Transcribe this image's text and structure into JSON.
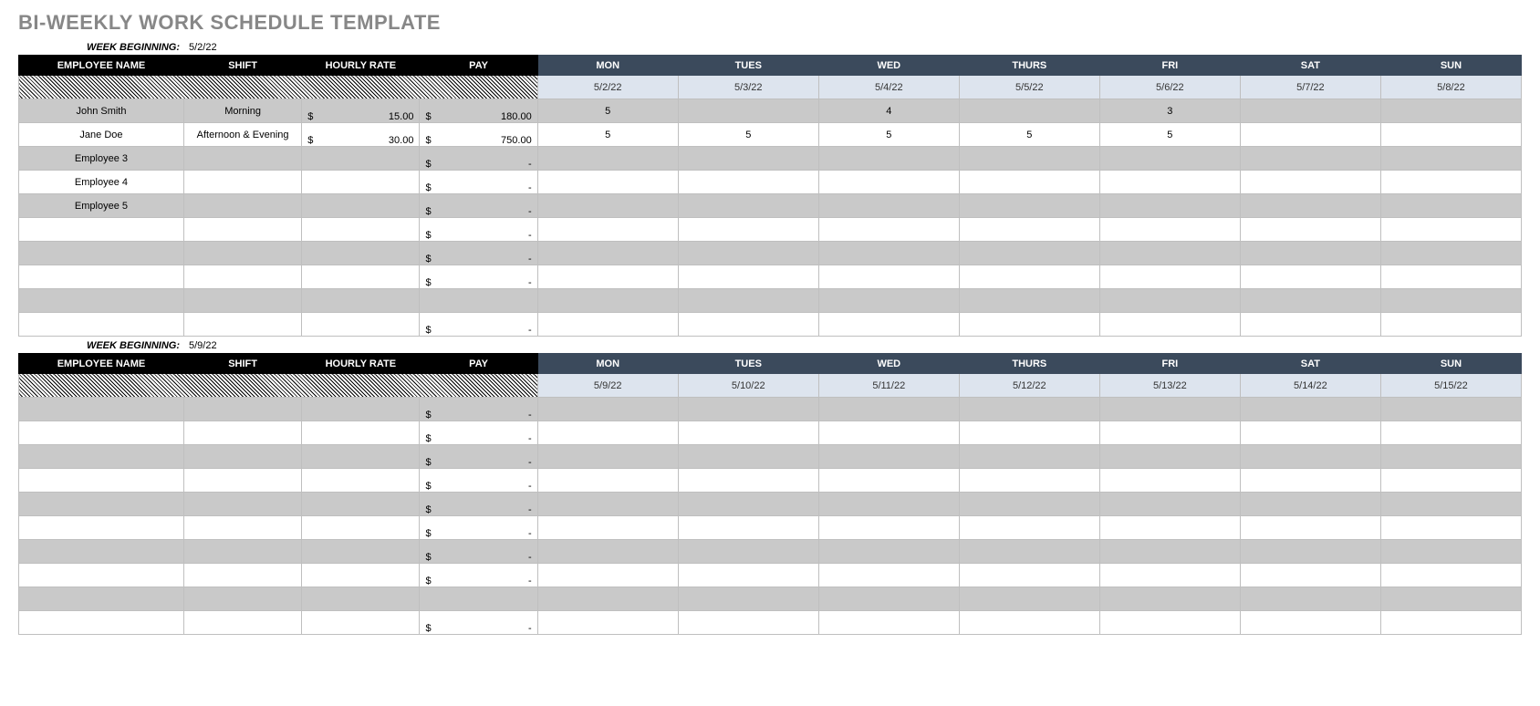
{
  "title": "BI-WEEKLY WORK SCHEDULE TEMPLATE",
  "labels": {
    "week_beg": "WEEK BEGINNING:",
    "emp_name": "EMPLOYEE NAME",
    "shift": "SHIFT",
    "rate": "HOURLY RATE",
    "pay": "PAY",
    "days": [
      "MON",
      "TUES",
      "WED",
      "THURS",
      "FRI",
      "SAT",
      "SUN"
    ],
    "dollar": "$",
    "dash": "-"
  },
  "weeks": [
    {
      "start": "5/2/22",
      "dates": [
        "5/2/22",
        "5/3/22",
        "5/4/22",
        "5/5/22",
        "5/6/22",
        "5/7/22",
        "5/8/22"
      ],
      "rows": [
        {
          "name": "John Smith",
          "shift": "Morning",
          "rate": "15.00",
          "pay": "180.00",
          "days": [
            "5",
            "",
            "4",
            "",
            "3",
            "",
            ""
          ]
        },
        {
          "name": "Jane Doe",
          "shift": "Afternoon & Evening",
          "rate": "30.00",
          "pay": "750.00",
          "days": [
            "5",
            "5",
            "5",
            "5",
            "5",
            "",
            ""
          ]
        },
        {
          "name": "Employee 3",
          "shift": "",
          "rate": "",
          "pay": "-",
          "days": [
            "",
            "",
            "",
            "",
            "",
            "",
            ""
          ]
        },
        {
          "name": "Employee 4",
          "shift": "",
          "rate": "",
          "pay": "-",
          "days": [
            "",
            "",
            "",
            "",
            "",
            "",
            ""
          ]
        },
        {
          "name": "Employee 5",
          "shift": "",
          "rate": "",
          "pay": "-",
          "days": [
            "",
            "",
            "",
            "",
            "",
            "",
            ""
          ]
        },
        {
          "name": "",
          "shift": "",
          "rate": "",
          "pay": "-",
          "days": [
            "",
            "",
            "",
            "",
            "",
            "",
            ""
          ]
        },
        {
          "name": "",
          "shift": "",
          "rate": "",
          "pay": "-",
          "days": [
            "",
            "",
            "",
            "",
            "",
            "",
            ""
          ]
        },
        {
          "name": "",
          "shift": "",
          "rate": "",
          "pay": "-",
          "days": [
            "",
            "",
            "",
            "",
            "",
            "",
            ""
          ]
        },
        {
          "name": "",
          "shift": "",
          "rate": "",
          "pay": "",
          "days": [
            "",
            "",
            "",
            "",
            "",
            "",
            ""
          ]
        },
        {
          "name": "",
          "shift": "",
          "rate": "",
          "pay": "-",
          "days": [
            "",
            "",
            "",
            "",
            "",
            "",
            ""
          ]
        }
      ]
    },
    {
      "start": "5/9/22",
      "dates": [
        "5/9/22",
        "5/10/22",
        "5/11/22",
        "5/12/22",
        "5/13/22",
        "5/14/22",
        "5/15/22"
      ],
      "rows": [
        {
          "name": "",
          "shift": "",
          "rate": "",
          "pay": "-",
          "days": [
            "",
            "",
            "",
            "",
            "",
            "",
            ""
          ]
        },
        {
          "name": "",
          "shift": "",
          "rate": "",
          "pay": "-",
          "days": [
            "",
            "",
            "",
            "",
            "",
            "",
            ""
          ]
        },
        {
          "name": "",
          "shift": "",
          "rate": "",
          "pay": "-",
          "days": [
            "",
            "",
            "",
            "",
            "",
            "",
            ""
          ]
        },
        {
          "name": "",
          "shift": "",
          "rate": "",
          "pay": "-",
          "days": [
            "",
            "",
            "",
            "",
            "",
            "",
            ""
          ]
        },
        {
          "name": "",
          "shift": "",
          "rate": "",
          "pay": "-",
          "days": [
            "",
            "",
            "",
            "",
            "",
            "",
            ""
          ]
        },
        {
          "name": "",
          "shift": "",
          "rate": "",
          "pay": "-",
          "days": [
            "",
            "",
            "",
            "",
            "",
            "",
            ""
          ]
        },
        {
          "name": "",
          "shift": "",
          "rate": "",
          "pay": "-",
          "days": [
            "",
            "",
            "",
            "",
            "",
            "",
            ""
          ]
        },
        {
          "name": "",
          "shift": "",
          "rate": "",
          "pay": "-",
          "days": [
            "",
            "",
            "",
            "",
            "",
            "",
            ""
          ]
        },
        {
          "name": "",
          "shift": "",
          "rate": "",
          "pay": "",
          "days": [
            "",
            "",
            "",
            "",
            "",
            "",
            ""
          ]
        },
        {
          "name": "",
          "shift": "",
          "rate": "",
          "pay": "-",
          "days": [
            "",
            "",
            "",
            "",
            "",
            "",
            ""
          ]
        }
      ]
    }
  ]
}
